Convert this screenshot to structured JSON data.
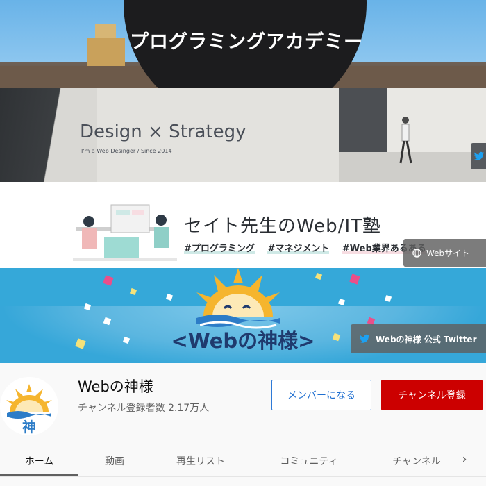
{
  "banners": [
    {
      "title": "プログラミングアカデミー"
    },
    {
      "logo": "Design × Strategy",
      "tagline": "I'm a Web Desinger / Since 2014"
    },
    {
      "heading": "セイト先生のWeb/IT塾",
      "tags": [
        "#プログラミング",
        "#マネジメント",
        "#Web業界あるある"
      ],
      "link": {
        "icon": "globe-icon",
        "label": "Webサイト"
      }
    },
    {
      "logo": "<Webの神様>",
      "link": {
        "icon": "twitter-icon",
        "label": "Webの神様 公式 Twitter"
      }
    }
  ],
  "channel": {
    "name": "Webの神様",
    "subscribers": "チャンネル登録者数 2.17万人",
    "avatar_text": "神",
    "member_button": "メンバーになる",
    "subscribe_button": "チャンネル登録"
  },
  "tabs": [
    {
      "label": "ホーム",
      "active": true
    },
    {
      "label": "動画"
    },
    {
      "label": "再生リスト"
    },
    {
      "label": "コミュニティ"
    },
    {
      "label": "チャンネル"
    }
  ],
  "colors": {
    "subscribe": "#cc0000",
    "member_border": "#2e7ad7",
    "twitter": "#1da1f2"
  }
}
